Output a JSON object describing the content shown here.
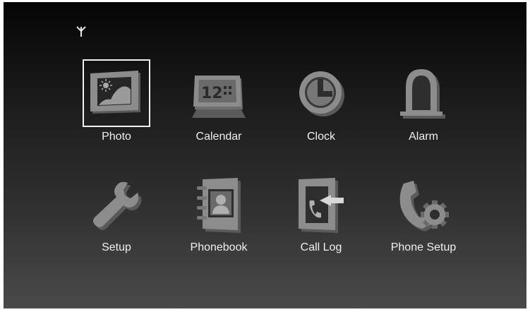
{
  "status": {
    "signal_icon": "antenna-signal-icon"
  },
  "menu": {
    "selected": "Photo",
    "items": [
      {
        "label": "Photo",
        "icon": "photo-frame-icon"
      },
      {
        "label": "Calendar",
        "icon": "calendar-icon"
      },
      {
        "label": "Clock",
        "icon": "clock-icon"
      },
      {
        "label": "Alarm",
        "icon": "bell-icon"
      },
      {
        "label": "Setup",
        "icon": "wrench-icon"
      },
      {
        "label": "Phonebook",
        "icon": "address-book-icon"
      },
      {
        "label": "Call Log",
        "icon": "call-log-icon"
      },
      {
        "label": "Phone Setup",
        "icon": "phone-gear-icon"
      }
    ]
  },
  "colors": {
    "background_top": "#050505",
    "background_bottom": "#4a4a4a",
    "icon_fill": "#8c8c8c",
    "label_text": "#f0f0f0",
    "selection_border": "#f2f2f2"
  }
}
